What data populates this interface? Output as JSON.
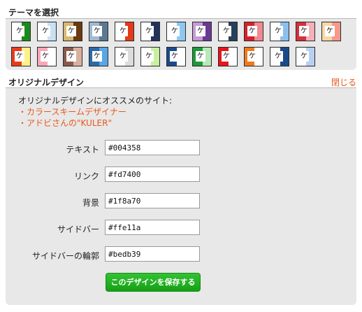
{
  "theme": {
    "title": "テーマを選択",
    "glyph": "ケ",
    "swatches_row1": [
      {
        "left": "#ffffff",
        "right": "#1a8a1a"
      },
      {
        "left": "#ffffff",
        "right": "#c8e0f4"
      },
      {
        "left": "#d8b870",
        "right": "#6a3a10"
      },
      {
        "left": "#9fb9cf",
        "right": "#5d7891"
      },
      {
        "left": "#ffffff",
        "right": "#e23a1a"
      },
      {
        "left": "#ffffff",
        "right": "#22325a"
      },
      {
        "left": "#ffffff",
        "right": "#8ec8ef"
      },
      {
        "left": "#c79bd8",
        "right": "#6a3a92"
      },
      {
        "left": "#ffffff",
        "right": "#24405a"
      },
      {
        "left": "#d6212a",
        "right": "#ef8a90"
      },
      {
        "left": "#ffffff",
        "right": "#8ac0ec"
      },
      {
        "left": "#d6303a",
        "right": "#f4b0b8"
      },
      {
        "left": "#fbd7a4",
        "right": "#f59a8a"
      }
    ],
    "swatches_row2": [
      {
        "left": "#e93a1a",
        "right": "#fff08a"
      },
      {
        "left": "#f6a7b8",
        "right": "#ffffff"
      },
      {
        "left": "#8a5a4a",
        "right": "#d8b0a0"
      },
      {
        "left": "#2b6aa8",
        "right": "#5aa6e2"
      },
      {
        "left": "#ffffff",
        "right": "#dcdcdc"
      },
      {
        "left": "#ffffff",
        "right": "#c8f0a0"
      },
      {
        "left": "#1a4a8a",
        "right": "#ffffff"
      },
      {
        "left": "#1a9a3a",
        "right": "#b8e8b8"
      },
      {
        "left": "#e8151a",
        "right": "#ffffff"
      },
      {
        "left": "#f07a1a",
        "right": "#ffffff"
      },
      {
        "left": "#ffffff",
        "right": "#1a4a8a"
      },
      {
        "left": "#ffffff",
        "right": "#b8d0f0"
      }
    ]
  },
  "design": {
    "title": "オリジナルデザイン",
    "close_label": "閉じる",
    "intro_text": "オリジナルデザインにオススメのサイト:",
    "bullet": "・",
    "links": [
      "カラースキームデザイナー",
      "アドビさんの\"KULER\""
    ],
    "fields": [
      {
        "label": "テキスト",
        "value": "#004358"
      },
      {
        "label": "リンク",
        "value": "#fd7400"
      },
      {
        "label": "背景",
        "value": "#1f8a70"
      },
      {
        "label": "サイドバー",
        "value": "#ffe11a"
      },
      {
        "label": "サイドバーの輪郭",
        "value": "#bedb39"
      }
    ],
    "save_button": "このデザインを保存する"
  },
  "colors": {
    "accent_orange": "#e8571b",
    "button_green": "#1fa31f",
    "panel_gray": "#e8e8e8"
  }
}
